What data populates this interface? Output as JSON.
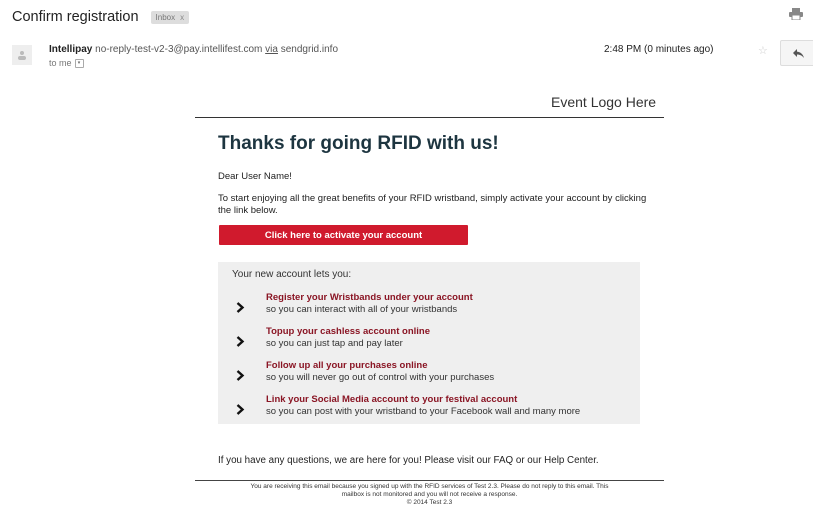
{
  "header": {
    "subject": "Confirm registration",
    "label": "Inbox",
    "label_close": "x"
  },
  "message": {
    "sender_name": "Intellipay",
    "sender_email": "no-reply-test-v2-3@pay.intellifest.com",
    "via_text": "via",
    "via_domain": "sendgrid.info",
    "to": "to me",
    "timestamp": "2:48 PM (0 minutes ago)"
  },
  "email": {
    "logo_text": "Event Logo Here",
    "headline": "Thanks for going RFID with us!",
    "greeting": "Dear User Name!",
    "intro": "To start enjoying all the great benefits of your RFID wristband, simply activate your account by clicking the link below.",
    "cta_label": "Click here to activate your account",
    "benefits_heading": "Your new account lets you:",
    "benefits": [
      {
        "title": "Register your Wristbands under your account",
        "subtitle": "so you can interact with all of your wristbands"
      },
      {
        "title": "Topup your cashless account online",
        "subtitle": "so you can just tap and pay later"
      },
      {
        "title": "Follow up all your purchases online",
        "subtitle": "so you will never go out of control with your purchases"
      },
      {
        "title": "Link your Social Media account to your festival account",
        "subtitle": "so you can post with your wristband to your Facebook wall and many more"
      }
    ],
    "questions": "If you have any questions, we are here for you! Please visit our FAQ or our Help Center.",
    "footer_line1": "You are receiving this email because you signed up with the RFID services of Test 2.3. Please do not reply to this email. This",
    "footer_line2": "mailbox is not monitored and you will not receive a response.",
    "footer_line3": "© 2014 Test 2.3"
  },
  "colors": {
    "headline": "#1d3540",
    "cta_background": "#d01a2d",
    "benefit_title": "#8a1524",
    "benefits_background": "#efefef"
  }
}
